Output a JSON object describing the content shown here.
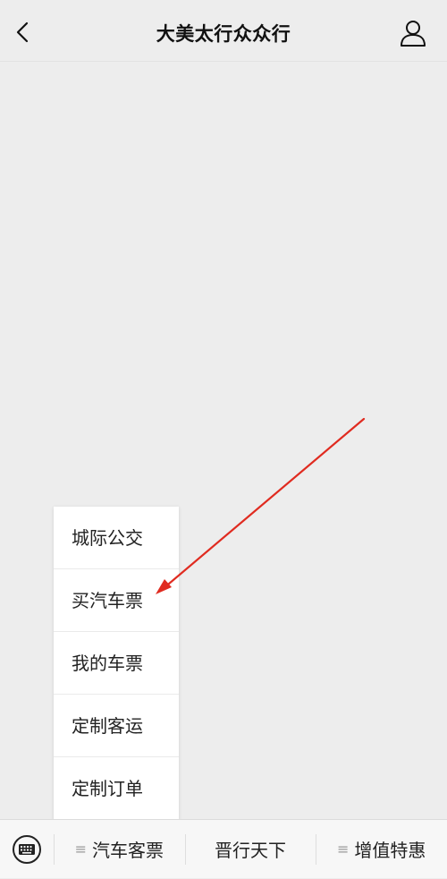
{
  "header": {
    "title": "大美太行众众行"
  },
  "submenu": {
    "items": [
      "城际公交",
      "买汽车票",
      "我的车票",
      "定制客运",
      "定制订单"
    ]
  },
  "bottom_menu": {
    "tabs": [
      {
        "label": "汽车客票",
        "has_submenu": true
      },
      {
        "label": "晋行天下",
        "has_submenu": false
      },
      {
        "label": "增值特惠",
        "has_submenu": true
      }
    ]
  },
  "colors": {
    "background": "#ededed",
    "annotation_arrow": "#e02b20"
  }
}
